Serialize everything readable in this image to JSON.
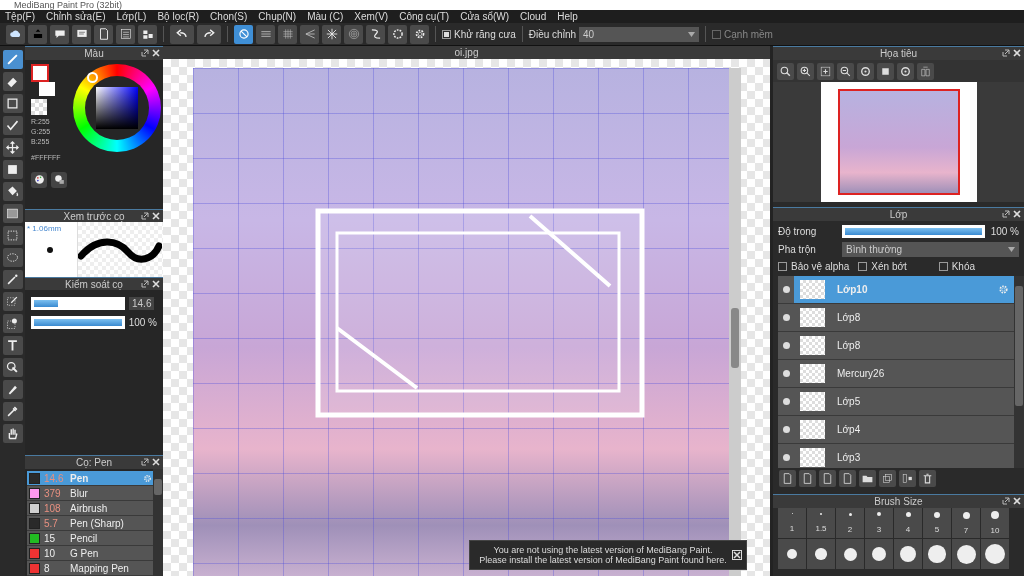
{
  "window": {
    "title": "MediBang Paint Pro (32bit)"
  },
  "menu": [
    "Tệp(F)",
    "Chỉnh sửa(E)",
    "Lớp(L)",
    "Bộ lọc(R)",
    "Chọn(S)",
    "Chụp(N)",
    "Màu (C)",
    "Xem(V)",
    "Công cụ(T)",
    "Cửa sổ(W)",
    "Cloud",
    "Help"
  ],
  "toolbar": {
    "snaps": [
      {
        "selected": true
      },
      {
        "selected": false
      },
      {
        "selected": false
      },
      {
        "selected": false
      },
      {
        "selected": false
      },
      {
        "selected": false
      },
      {
        "selected": false
      },
      {
        "selected": false
      },
      {
        "selected": false
      }
    ],
    "antialias": {
      "label": "Khử răng cưa",
      "checked": true
    },
    "adjust": {
      "label": "Điều chỉnh",
      "value": "40"
    },
    "soft_edge": {
      "label": "Cạnh mềm",
      "checked": false
    }
  },
  "tools": [
    {
      "selected": true
    },
    {
      "selected": false
    },
    {
      "selected": false
    },
    {
      "selected": false
    },
    {
      "selected": false
    },
    {
      "selected": false
    },
    {
      "selected": false
    },
    {
      "selected": false
    },
    {
      "selected": false
    },
    {
      "selected": false
    },
    {
      "selected": false
    },
    {
      "selected": false
    },
    {
      "selected": false
    },
    {
      "selected": false
    },
    {
      "selected": false
    },
    {
      "selected": false
    },
    {
      "selected": false
    },
    {
      "selected": false
    }
  ],
  "color_panel": {
    "title": "Màu",
    "rgb": [
      "R:255",
      "G:255",
      "B:255"
    ],
    "hex": "#FFFFFF"
  },
  "brush_preview": {
    "title": "Xem trước cọ",
    "size": "* 1.06mm"
  },
  "brush_control": {
    "title": "Kiểm soát cọ",
    "size": {
      "level": 0.27,
      "value": "14.6"
    },
    "opacity": {
      "level": 1,
      "value": "100 %"
    }
  },
  "brush_list": {
    "title": "Cọ: Pen",
    "items": [
      {
        "size": "14.6",
        "name": "Pen",
        "color": "#2a2a2a",
        "marked": true,
        "selected": true
      },
      {
        "size": "379",
        "name": "Blur",
        "color": "#ff99ee",
        "marked": true,
        "selected": false
      },
      {
        "size": "108",
        "name": "Airbrush",
        "color": "#d0d0d0",
        "marked": true,
        "selected": false
      },
      {
        "size": "5.7",
        "name": "Pen (Sharp)",
        "color": "#2a2a2a",
        "marked": true,
        "selected": false
      },
      {
        "size": "15",
        "name": "Pencil",
        "color": "#22bb22",
        "marked": false,
        "selected": false
      },
      {
        "size": "10",
        "name": "G Pen",
        "color": "#ee3333",
        "marked": false,
        "selected": false
      },
      {
        "size": "8",
        "name": "Mapping Pen",
        "color": "#ee3333",
        "marked": false,
        "selected": false
      }
    ]
  },
  "document": {
    "tab": "oi.jpg"
  },
  "notification": {
    "lines": [
      "You are not using the latest version of MediBang Paint.",
      "Please install the latest version of MediBang Paint found here."
    ]
  },
  "navigator": {
    "title": "Họa tiêu"
  },
  "layers": {
    "title": "Lớp",
    "opacity": {
      "label": "Độ trong",
      "level": 1,
      "value": "100 %"
    },
    "blend": {
      "label": "Pha trộn",
      "value": "Bình thường"
    },
    "options": [
      {
        "label": "Bảo vệ alpha",
        "checked": false
      },
      {
        "label": "Xén bớt",
        "checked": false
      },
      {
        "label": "Khóa",
        "checked": false
      }
    ],
    "items": [
      {
        "name": "Lớp10",
        "selected": true,
        "visible": true
      },
      {
        "name": "Lớp8",
        "selected": false,
        "visible": true
      },
      {
        "name": "Lớp8",
        "selected": false,
        "visible": true
      },
      {
        "name": "Mercury26",
        "selected": false,
        "visible": true
      },
      {
        "name": "Lớp5",
        "selected": false,
        "visible": true
      },
      {
        "name": "Lớp4",
        "selected": false,
        "visible": true
      },
      {
        "name": "Lớp3",
        "selected": false,
        "visible": true
      }
    ]
  },
  "brush_size": {
    "title": "Brush Size",
    "sizes": [
      "1",
      "1.5",
      "2",
      "3",
      "4",
      "5",
      "7",
      "10"
    ]
  }
}
